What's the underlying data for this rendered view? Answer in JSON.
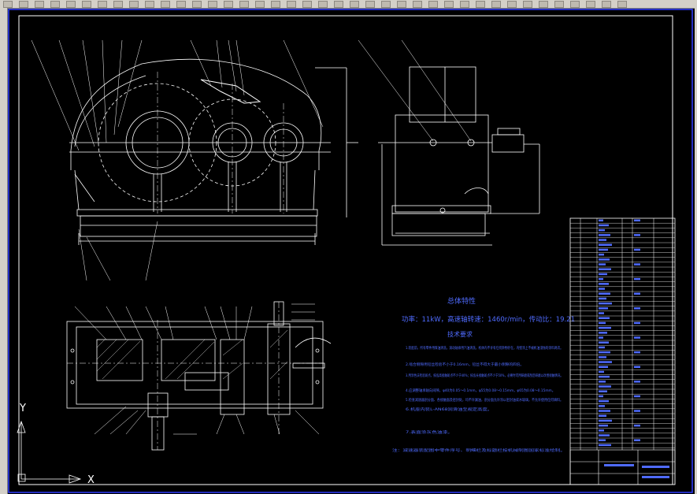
{
  "toolbar": {
    "buttons": 40
  },
  "drawing": {
    "params_title": "总体特性",
    "params_line": "功率：11kW，高速轴转速：1460r/min，传动比：19.21",
    "tech_title": "技术要求",
    "requirements": [
      "1.装配前，所有零件用煤油清洗，滚动轴承用汽油清洗，机体内不许有任何杂物存在，内壁涂上不被机油浸蚀的涂料两次。",
      "2.啮合侧隙用铅丝检验不小于0.16mm，铅丝不得大于最小侧隙的四倍。",
      "3.用涂色法检验斑点，按齿高接触斑点不少于40%；按齿长接触斑点不少于50%，必要时可用研磨或刮后研磨以改善接触情况。",
      "4.应调整轴承轴向间隙，φ40为0.05～0.1mm，φ55为0.08～0.15mm，φ65为0.08～0.15mm。",
      "5.检查减速器剖分面、各接触面及密封处，均不许漏油，剖分面允许涂以密封油或水玻璃，不允许使用任何填料。",
      "6.机座内装L-AN68润滑油至规定高度。",
      "7.表面涂灰色油漆。"
    ],
    "note": "注：减速器装配图中零件序号、明细栏及标题栏按机械制图国家标准绘制。",
    "ucs_y": "Y",
    "ucs_x": "X"
  },
  "colors": {
    "line": "#ffffff",
    "text": "#4f6bff",
    "frame": "#2f3cff",
    "background": "#000000"
  }
}
